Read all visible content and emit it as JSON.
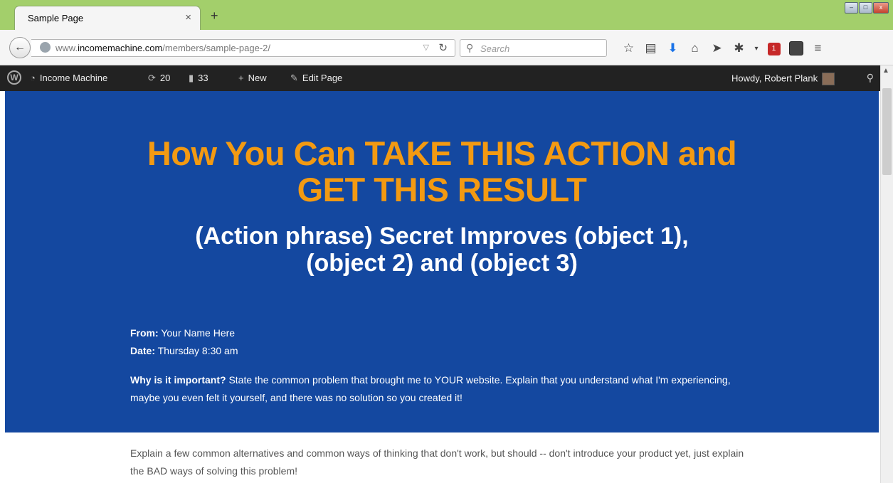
{
  "browser": {
    "tab_title": "Sample Page",
    "tab_close": "×",
    "new_tab": "+",
    "url_prefix": "www.",
    "url_domain": "incomemachine.com",
    "url_path": "/members/sample-page-2/",
    "search_placeholder": "Search",
    "window_controls": [
      "–",
      "□",
      "x"
    ],
    "toolbar_icons": [
      "star-icon",
      "reading-list-icon",
      "download-icon",
      "home-icon",
      "send-icon",
      "extension-icon",
      "menu-dropdown-icon",
      "badge-extension-icon",
      "screenshot-icon",
      "hamburger-menu-icon"
    ],
    "badge_count": "1"
  },
  "admin_bar": {
    "site_name": "Income Machine",
    "updates_count": "20",
    "comments_count": "33",
    "new_label": "New",
    "edit_label": "Edit Page",
    "howdy": "Howdy, Robert Plank"
  },
  "hero": {
    "headline_line1": "How You Can TAKE THIS ACTION and",
    "headline_line2": "GET THIS RESULT",
    "subheadline_line1": "(Action phrase) Secret Improves (object 1),",
    "subheadline_line2": "(object 2) and (object 3)",
    "from_label": "From:",
    "from_value": "Your Name Here",
    "date_label": "Date:",
    "date_value": "Thursday 8:30 am",
    "why_label": "Why is it important?",
    "why_text": "State the common problem that brought me to YOUR website. Explain that you understand what I'm experiencing, maybe you even felt it yourself, and there was no solution so you created it!"
  },
  "body": {
    "paragraph": "Explain a few common alternatives and common ways of thinking that don't work, but should -- don't introduce your product yet, just explain the BAD ways of solving this problem!"
  },
  "colors": {
    "hero_bg": "#1448a0",
    "headline": "#f39a12",
    "titlebar": "#a3cf6b",
    "adminbar": "#222222"
  }
}
